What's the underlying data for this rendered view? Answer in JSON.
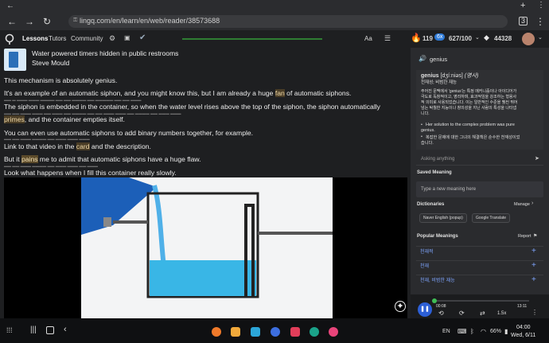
{
  "browser": {
    "url": "lingq.com/en/learn/en/web/reader/38573688"
  },
  "header": {
    "tab_lessons": "Lessons",
    "tab_tutors": "Tutors",
    "tab_community": "Community",
    "aa_label": "Aa",
    "streak": "119",
    "multiplier": "6x",
    "progress": "627/100",
    "coins": "44328"
  },
  "lesson": {
    "title": "Water powered timers hidden in public restrooms",
    "author": "Steve Mould",
    "line1": "This mechanism is absolutely genius.",
    "line2a": "It's an example of an automatic siphon, and you might know this, but I am already a huge ",
    "line2b": "fan",
    "line2c": " of automatic siphons.",
    "line3": "The siphon is embedded in the container, so when the water level rises above the top of the siphon, the siphon automatically",
    "line4a": "primes",
    "line4b": ", and the container empties itself.",
    "line5": "You can even use automatic siphons to add binary numbers together, for example.",
    "line6a": "Link to that video in the ",
    "line6b": "card",
    "line6c": " and the description.",
    "line7a": "But it ",
    "line7b": "pains",
    "line7c": " me to admit that automatic siphons have a huge flaw.",
    "line8": "Look what happens when I fill this container really slowly."
  },
  "panel": {
    "word": "genius",
    "headword": "genius",
    "ipa": "[dʒíːniəs]",
    "pos": "(명사)",
    "short_def": "천재성; 비범한 재능",
    "def1": "주어진 문맥에서 'genius'는 특정 메커니즘이나 아이디어가",
    "def2": "극도로 독창적이고, 영리하며, 효과적임을 강조하는 형용사",
    "def3": "적 의미로 사용되었습니다. 이는 일반적인 수준을 훨씬 뛰어",
    "def4": "넘는 탁월한 지능이나 창의성을 지닌 사람의 특성을 나타냅",
    "def5": "니다.",
    "ex1": "Her solution to the complex problem was pure",
    "ex1b": "genius.",
    "ex2": "복잡한 문제에 대한 그녀의 해결책은 순수한 천재성이었",
    "ex2b": "습니다.",
    "ask_placeholder": "Asking anything",
    "saved_heading": "Saved Meaning",
    "saved_placeholder": "Type a new meaning here",
    "dict_heading": "Dictionaries",
    "manage": "Manage",
    "dict1": "Naver English (popup)",
    "dict2": "Google Translate",
    "popular_heading": "Popular Meanings",
    "report": "Report",
    "meanings": [
      "천재적",
      "천재",
      "천재, 비범한 재능"
    ]
  },
  "player": {
    "elapsed": "00:08",
    "total": "13:11",
    "progress_fraction": 0.01,
    "speed": "1.5x"
  },
  "system": {
    "lang": "EN",
    "battery": "66%",
    "time": "04:00",
    "date": "Wed, 6/11"
  },
  "colors": {
    "accent": "#2e7d32",
    "highlight": "#4a3d26",
    "streak": "#ff6b2b",
    "chip_blue": "#2f7bd8",
    "meaning_blue": "#3d7cf0"
  }
}
